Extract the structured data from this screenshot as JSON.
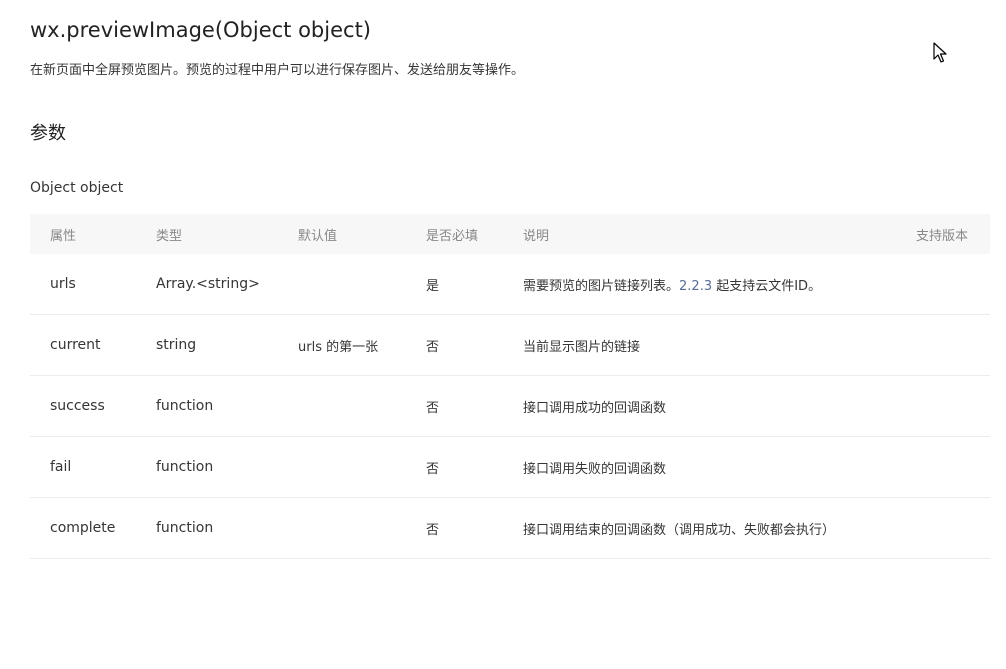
{
  "header": {
    "title": "wx.previewImage(Object object)",
    "description": "在新页面中全屏预览图片。预览的过程中用户可以进行保存图片、发送给朋友等操作。"
  },
  "params_section": {
    "title": "参数",
    "object_label": "Object object"
  },
  "table": {
    "columns": [
      "属性",
      "类型",
      "默认值",
      "是否必填",
      "说明",
      "支持版本"
    ],
    "rows": [
      {
        "prop": "urls",
        "type": "Array.<string>",
        "default": "",
        "required": "是",
        "desc_before": "需要预览的图片链接列表。",
        "desc_link": "2.2.3",
        "desc_after": " 起支持云文件ID。",
        "version": ""
      },
      {
        "prop": "current",
        "type": "string",
        "default": "urls 的第一张",
        "required": "否",
        "desc_before": "当前显示图片的链接",
        "desc_link": "",
        "desc_after": "",
        "version": ""
      },
      {
        "prop": "success",
        "type": "function",
        "default": "",
        "required": "否",
        "desc_before": "接口调用成功的回调函数",
        "desc_link": "",
        "desc_after": "",
        "version": ""
      },
      {
        "prop": "fail",
        "type": "function",
        "default": "",
        "required": "否",
        "desc_before": "接口调用失败的回调函数",
        "desc_link": "",
        "desc_after": "",
        "version": ""
      },
      {
        "prop": "complete",
        "type": "function",
        "default": "",
        "required": "否",
        "desc_before": "接口调用结束的回调函数（调用成功、失败都会执行）",
        "desc_link": "",
        "desc_after": "",
        "version": ""
      }
    ]
  },
  "colors": {
    "link": "#576b95",
    "header_bg": "#f7f7f7",
    "border": "#ececec"
  },
  "icons": {
    "cursor": "mouse-pointer-icon"
  }
}
